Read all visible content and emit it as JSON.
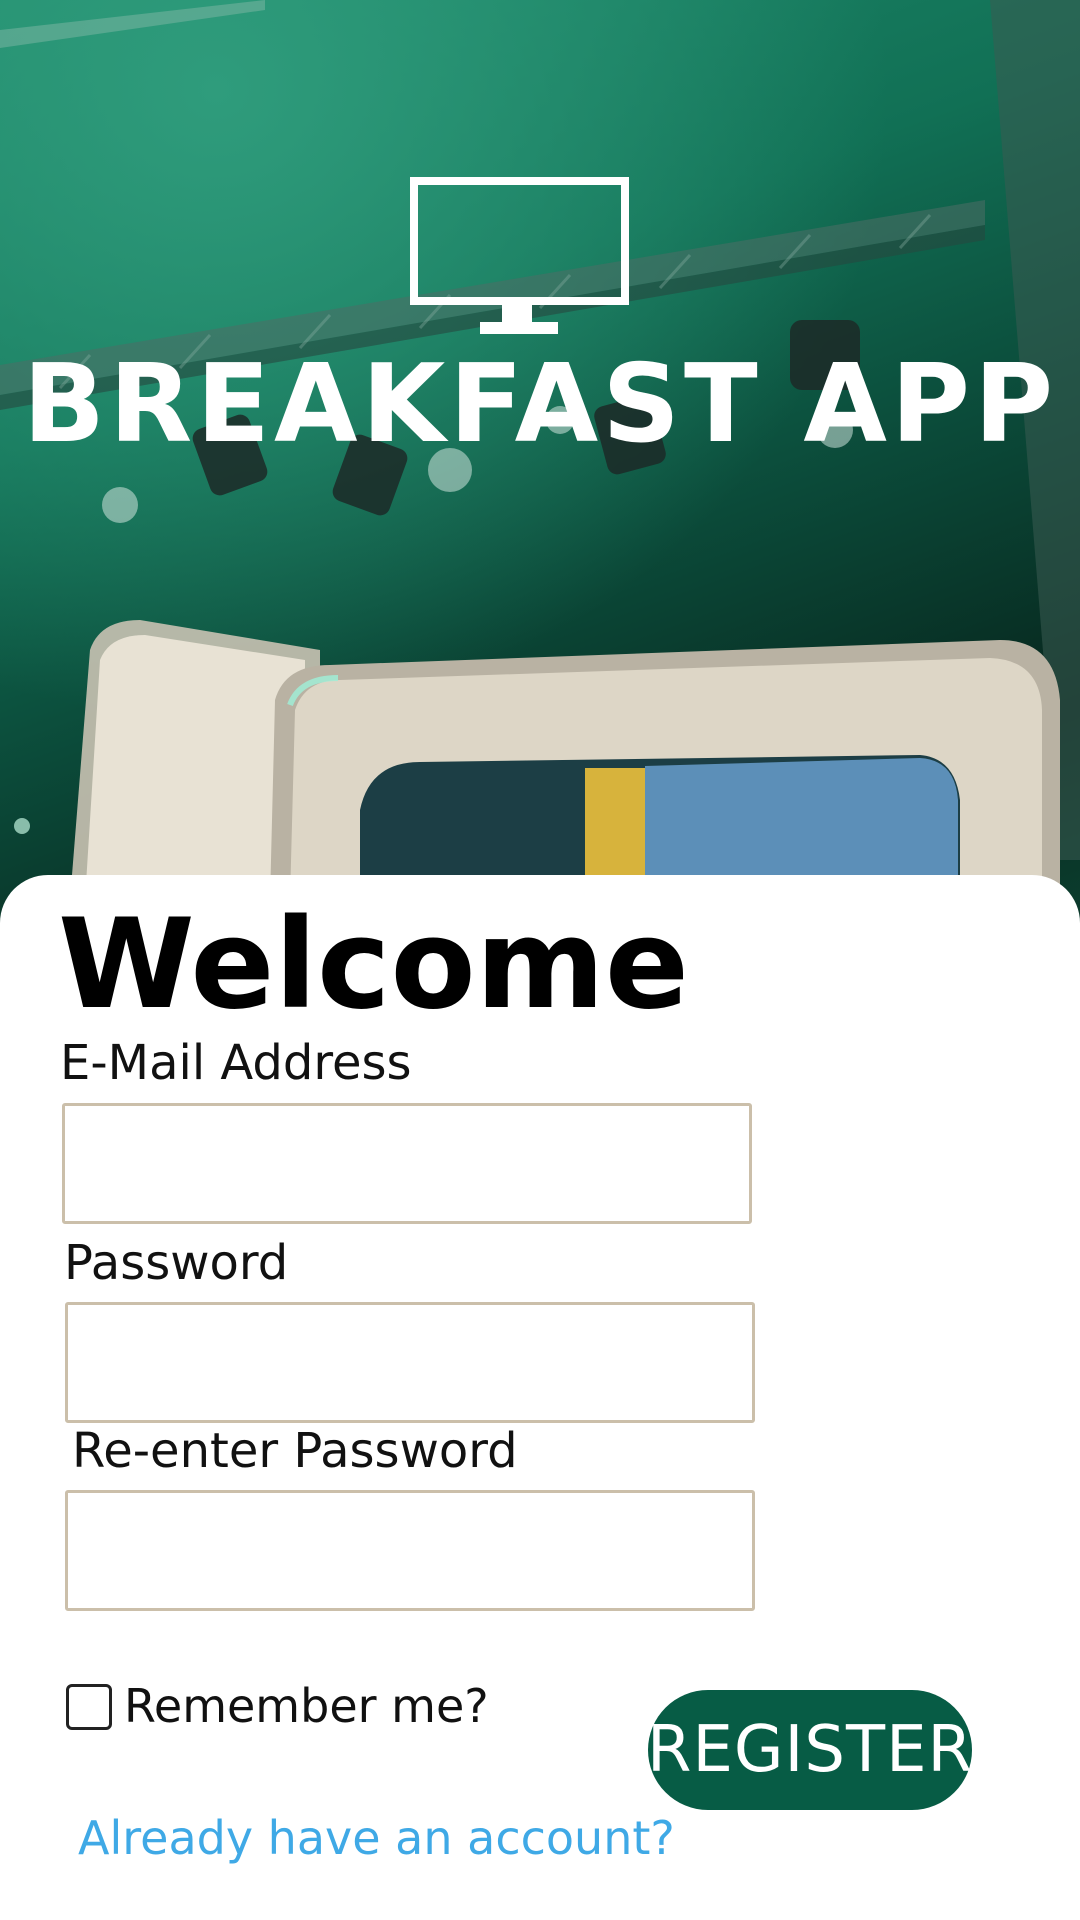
{
  "app": {
    "brand": "BREAKFAST APP",
    "logo_icon": "tv-monitor-icon"
  },
  "form": {
    "title": "Welcome",
    "email_label": "E-Mail Address",
    "email_value": "",
    "password_label": "Password",
    "password_value": "",
    "reenter_label": "Re-enter Password",
    "reenter_value": "",
    "remember_label": "Remember me?",
    "remember_checked": false,
    "register_label": "REGISTER",
    "login_link": "Already have an account?"
  },
  "colors": {
    "accent": "#075c45",
    "link": "#3fa9e6",
    "field_border": "#cbbfaa",
    "hero_green": "#117055"
  }
}
